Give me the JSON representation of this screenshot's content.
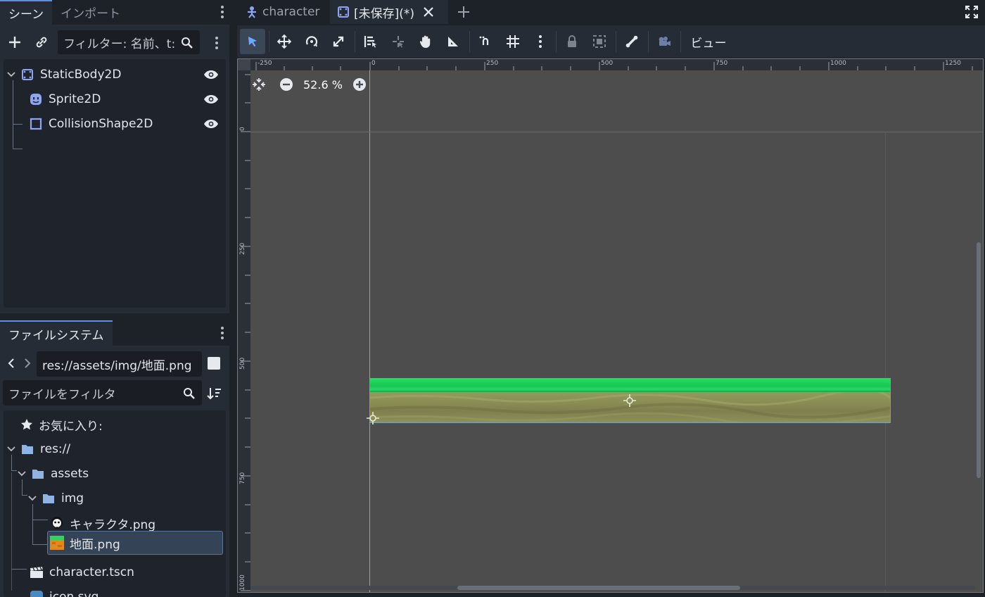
{
  "scene_dock": {
    "tabs": [
      "シーン",
      "インポート"
    ],
    "filter_placeholder": "フィルター: 名前、t:",
    "nodes": [
      {
        "label": "StaticBody2D",
        "icon": "static-body-2d-icon",
        "depth": 0
      },
      {
        "label": "Sprite2D",
        "icon": "sprite-2d-icon",
        "depth": 1
      },
      {
        "label": "CollisionShape2D",
        "icon": "collision-shape-2d-icon",
        "depth": 1
      }
    ]
  },
  "filesystem_dock": {
    "tab": "ファイルシステム",
    "path": "res://assets/img/地面.png",
    "filter_placeholder": "ファイルをフィルタ",
    "favorites_label": "お気に入り:",
    "items": [
      {
        "label": "res://",
        "type": "folder"
      },
      {
        "label": "assets",
        "type": "folder"
      },
      {
        "label": "img",
        "type": "folder"
      },
      {
        "label": "キャラクタ.png",
        "type": "image"
      },
      {
        "label": "地面.png",
        "type": "image",
        "selected": true
      },
      {
        "label": "character.tscn",
        "type": "scene"
      },
      {
        "label": "icon.svg",
        "type": "svg"
      }
    ]
  },
  "editor_tabs": [
    {
      "label": "character",
      "active": false
    },
    {
      "label": "[未保存](*)",
      "active": true
    }
  ],
  "toolbar": {
    "view_label": "ビュー"
  },
  "viewport": {
    "zoom": "52.6 %",
    "ruler_x": [
      "-250",
      "0",
      "250",
      "500",
      "750",
      "1000",
      "1250"
    ],
    "ruler_y": [
      "0",
      "250",
      "500",
      "750",
      "1000"
    ]
  },
  "colors": {
    "accent": "#5b8fe6",
    "node_2d": "#8da5f3",
    "grass": "#1fd35d",
    "dirt": "#8b8c57"
  }
}
